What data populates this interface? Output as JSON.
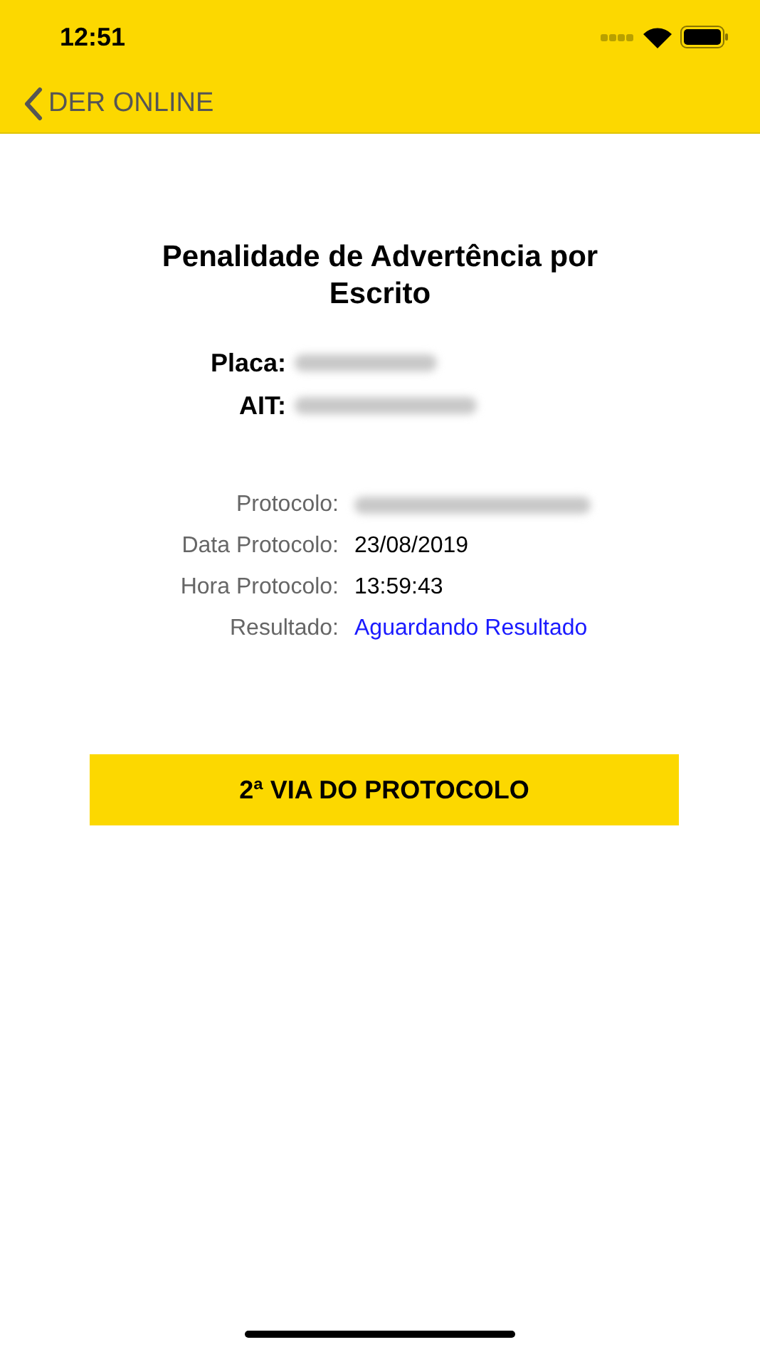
{
  "status_bar": {
    "time": "12:51"
  },
  "nav": {
    "back_label": "DER ONLINE"
  },
  "title": "Penalidade de Advertência por Escrito",
  "vehicle": [
    {
      "label": "Placa:",
      "kind": "redacted"
    },
    {
      "label": "AIT:",
      "kind": "redacted"
    }
  ],
  "details": [
    {
      "label": "Protocolo:",
      "kind": "redacted"
    },
    {
      "label": "Data Protocolo:",
      "kind": "text",
      "value": "23/08/2019"
    },
    {
      "label": "Hora Protocolo:",
      "kind": "text",
      "value": "13:59:43"
    },
    {
      "label": "Resultado:",
      "kind": "link",
      "value": "Aguardando Resultado"
    }
  ],
  "button": "2ª VIA DO PROTOCOLO"
}
